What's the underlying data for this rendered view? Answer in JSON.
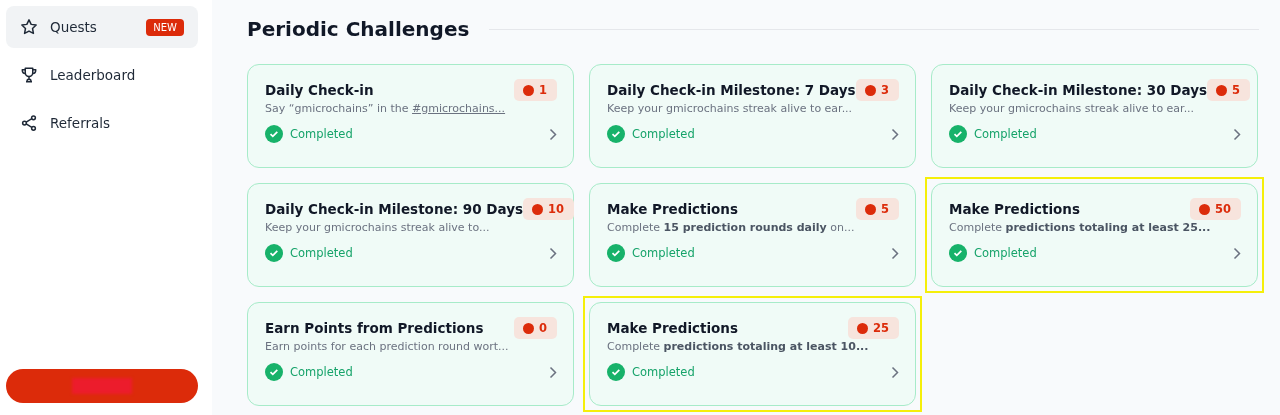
{
  "sidebar": {
    "items": [
      {
        "label": "Quests",
        "badge": "NEW",
        "selected": true
      },
      {
        "label": "Leaderboard",
        "selected": false
      },
      {
        "label": "Referrals",
        "selected": false
      }
    ],
    "action_button": {
      "redacted": true
    }
  },
  "section": {
    "title": "Periodic Challenges"
  },
  "challenges": [
    {
      "title": "Daily Check-in",
      "description": "Say “gmicrochains” in the ",
      "link": "#gmicrochains...",
      "points": "1",
      "status": "Completed",
      "highlighted": false
    },
    {
      "title": "Daily Check-in Milestone: 7 Days",
      "description": "Keep your gmicrochains streak alive to ear...",
      "points": "3",
      "status": "Completed",
      "highlighted": false
    },
    {
      "title": "Daily Check-in Milestone: 30 Days",
      "description": "Keep your gmicrochains streak alive to ear...",
      "points": "5",
      "status": "Completed",
      "highlighted": false
    },
    {
      "title": "Daily Check-in Milestone: 90 Days",
      "description": "Keep your gmicrochains streak alive to...",
      "points": "10",
      "status": "Completed",
      "highlighted": false
    },
    {
      "title": "Make Predictions",
      "description": "Complete **15 prediction rounds daily** on...",
      "points": "5",
      "status": "Completed",
      "highlighted": false
    },
    {
      "title": "Make Predictions",
      "description": "Complete **predictions totaling at least 25...**",
      "points": "50",
      "status": "Completed",
      "highlighted": true
    },
    {
      "title": "Earn Points from Predictions",
      "description": "Earn points for each prediction round wort...",
      "points": "0",
      "status": "Completed",
      "highlighted": false
    },
    {
      "title": "Make Predictions",
      "description": "Complete **predictions totaling at least 10...**",
      "points": "25",
      "status": "Completed",
      "highlighted": true
    }
  ]
}
